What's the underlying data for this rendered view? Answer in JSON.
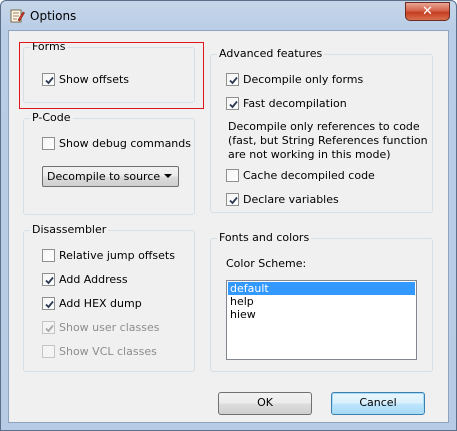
{
  "window": {
    "title": "Options",
    "close_glyph": "✕"
  },
  "forms": {
    "title": "Forms",
    "show_offsets": {
      "label": "Show offsets",
      "checked": true
    }
  },
  "pcode": {
    "title": "P-Code",
    "show_debug": {
      "label": "Show debug commands",
      "checked": false
    },
    "mode_select": "Decompile to source"
  },
  "disassembler": {
    "title": "Disassembler",
    "items": [
      {
        "label": "Relative jump offsets",
        "checked": false,
        "enabled": true
      },
      {
        "label": "Add Address",
        "checked": true,
        "enabled": true
      },
      {
        "label": "Add HEX dump",
        "checked": true,
        "enabled": true
      },
      {
        "label": "Show user classes",
        "checked": true,
        "enabled": false
      },
      {
        "label": "Show VCL classes",
        "checked": false,
        "enabled": false
      }
    ]
  },
  "advanced": {
    "title": "Advanced features",
    "decompile_only_forms": {
      "label": "Decompile only forms",
      "checked": true
    },
    "fast_decompilation": {
      "label": "Fast decompilation",
      "checked": true
    },
    "note_lines": [
      "Decompile only references to code",
      "(fast, but String References function",
      "are not working  in this mode)"
    ],
    "cache_decompiled": {
      "label": "Cache decompiled code",
      "checked": false
    },
    "declare_variables": {
      "label": "Declare variables",
      "checked": true
    }
  },
  "fonts_colors": {
    "title": "Fonts and colors",
    "scheme_label": "Color Scheme:",
    "schemes": [
      "default",
      "help",
      "hiew"
    ],
    "selected_index": 0
  },
  "buttons": {
    "ok": "OK",
    "cancel": "Cancel"
  },
  "icons": {
    "app": "notepad-pencil-icon",
    "close": "close-icon",
    "check": "checkmark-icon",
    "dropdown": "chevron-down-icon"
  },
  "colors": {
    "highlight_border": "#e0151b",
    "selection": "#3399ff",
    "close_button": "#c43d22"
  }
}
